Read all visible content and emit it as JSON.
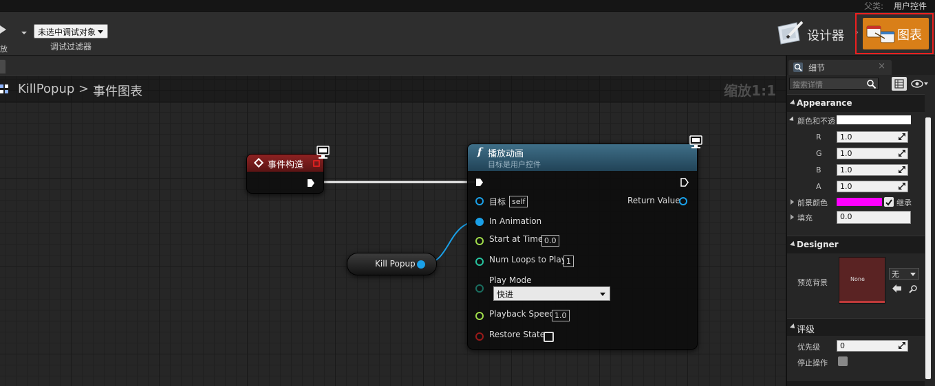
{
  "top_bar": {
    "parent_label": "父类:",
    "parent_value": "用户控件"
  },
  "toolbar": {
    "play_label": "放",
    "debug_select": "未选中调试对象",
    "debug_filter_label": "调试过滤器",
    "designer_label": "设计器",
    "graph_label": "图表",
    "mode_separator": "›"
  },
  "graph": {
    "breadcrumb": {
      "root": "KillPopup",
      "separator": ">",
      "leaf": "事件图表"
    },
    "zoom": "缩放1:1",
    "event_node": {
      "title": "事件构造"
    },
    "function_node": {
      "icon_glyph": "f",
      "title": "播放动画",
      "subtitle": "目标是用户控件",
      "pins": {
        "target_label": "目标",
        "target_value": "self",
        "return_label": "Return Value",
        "in_animation_label": "In Animation",
        "start_time_label": "Start at Time",
        "start_time_value": "0.0",
        "num_loops_label": "Num Loops to Play",
        "num_loops_value": "1",
        "play_mode_label": "Play Mode",
        "play_mode_value": "快进",
        "playback_speed_label": "Playback Speed",
        "playback_speed_value": "1.0",
        "restore_state_label": "Restore State"
      }
    },
    "variable_node": {
      "label": "Kill Popup"
    }
  },
  "details": {
    "tab_label": "细节",
    "tab_close": "×",
    "search_placeholder": "搜索详情",
    "appearance": {
      "header": "Appearance",
      "color_opacity_label": "颜色和不透",
      "r_label": "R",
      "r_value": "1.0",
      "g_label": "G",
      "g_value": "1.0",
      "b_label": "B",
      "b_value": "1.0",
      "a_label": "A",
      "a_value": "1.0",
      "foreground_label": "前景颜色",
      "inherit_label": "继承",
      "padding_label": "填充",
      "padding_value": "0.0"
    },
    "designer": {
      "header": "Designer",
      "preview_bg_label": "预览背景",
      "preview_value": "None",
      "preview_select": "无"
    },
    "rating": {
      "header": "评级",
      "priority_label": "优先级",
      "priority_value": "0",
      "stop_action_label": "停止操作"
    }
  },
  "colors": {
    "accent_orange": "#d97f18",
    "event_red": "#8e2222",
    "function_blue": "#3f6f88",
    "object_pin_blue": "#1aa0e8",
    "float_pin_green": "#9fdc4a",
    "int_pin_teal": "#27c5a0",
    "bool_pin_red": "#9b1a1a",
    "foreground_magenta": "#ff00ff",
    "highlight_red": "#ee2020"
  }
}
